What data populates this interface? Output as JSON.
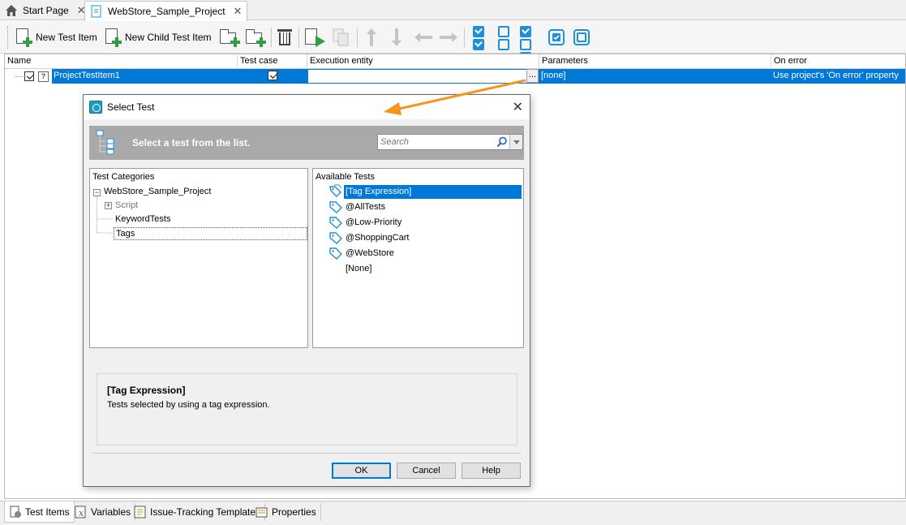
{
  "doc_tabs": [
    {
      "label": "Start Page",
      "icon": "home-icon"
    },
    {
      "label": "WebStore_Sample_Project",
      "icon": "project-icon"
    }
  ],
  "toolbar": {
    "new_test_item": "New Test Item",
    "new_child_test_item": "New Child Test Item"
  },
  "grid": {
    "columns": [
      "Name",
      "Test case",
      "Execution entity",
      "Parameters",
      "On error"
    ],
    "row": {
      "name": "ProjectTestItem1",
      "test_case_checked": true,
      "execution_entity": "",
      "ellipsis": "...",
      "parameters": "[none]",
      "on_error": "Use project's 'On error' property"
    }
  },
  "dialog": {
    "title": "Select Test",
    "banner_text": "Select a test from the list.",
    "search_placeholder": "Search",
    "categories_header": "Test Categories",
    "categories": {
      "root": "WebStore_Sample_Project",
      "script": "Script",
      "keyword_tests": "KeywordTests",
      "tags": "Tags"
    },
    "available_header": "Available Tests",
    "available_tests": [
      {
        "label": "[Tag Expression]",
        "selected": true,
        "icon": "tag-expression-icon"
      },
      {
        "label": "@AllTests",
        "selected": false,
        "icon": "tag-icon"
      },
      {
        "label": "@Low-Priority",
        "selected": false,
        "icon": "tag-icon"
      },
      {
        "label": "@ShoppingCart",
        "selected": false,
        "icon": "tag-icon"
      },
      {
        "label": "@WebStore",
        "selected": false,
        "icon": "tag-icon"
      },
      {
        "label": "[None]",
        "selected": false,
        "icon": ""
      }
    ],
    "description_title": "[Tag Expression]",
    "description_text": "Tests selected by using a tag expression.",
    "buttons": {
      "ok": "OK",
      "cancel": "Cancel",
      "help": "Help"
    }
  },
  "bottom_tabs": [
    {
      "label": "Test Items",
      "icon": "test-items-icon"
    },
    {
      "label": "Variables",
      "icon": "variables-icon"
    },
    {
      "label": "Issue-Tracking Templates",
      "icon": "issue-tracking-icon"
    },
    {
      "label": "Properties",
      "icon": "properties-icon"
    }
  ],
  "colors": {
    "selection": "#0078d7",
    "accent_blue": "#1e90d8",
    "callout_arrow": "#f7941d",
    "banner": "#a9a9a9"
  }
}
